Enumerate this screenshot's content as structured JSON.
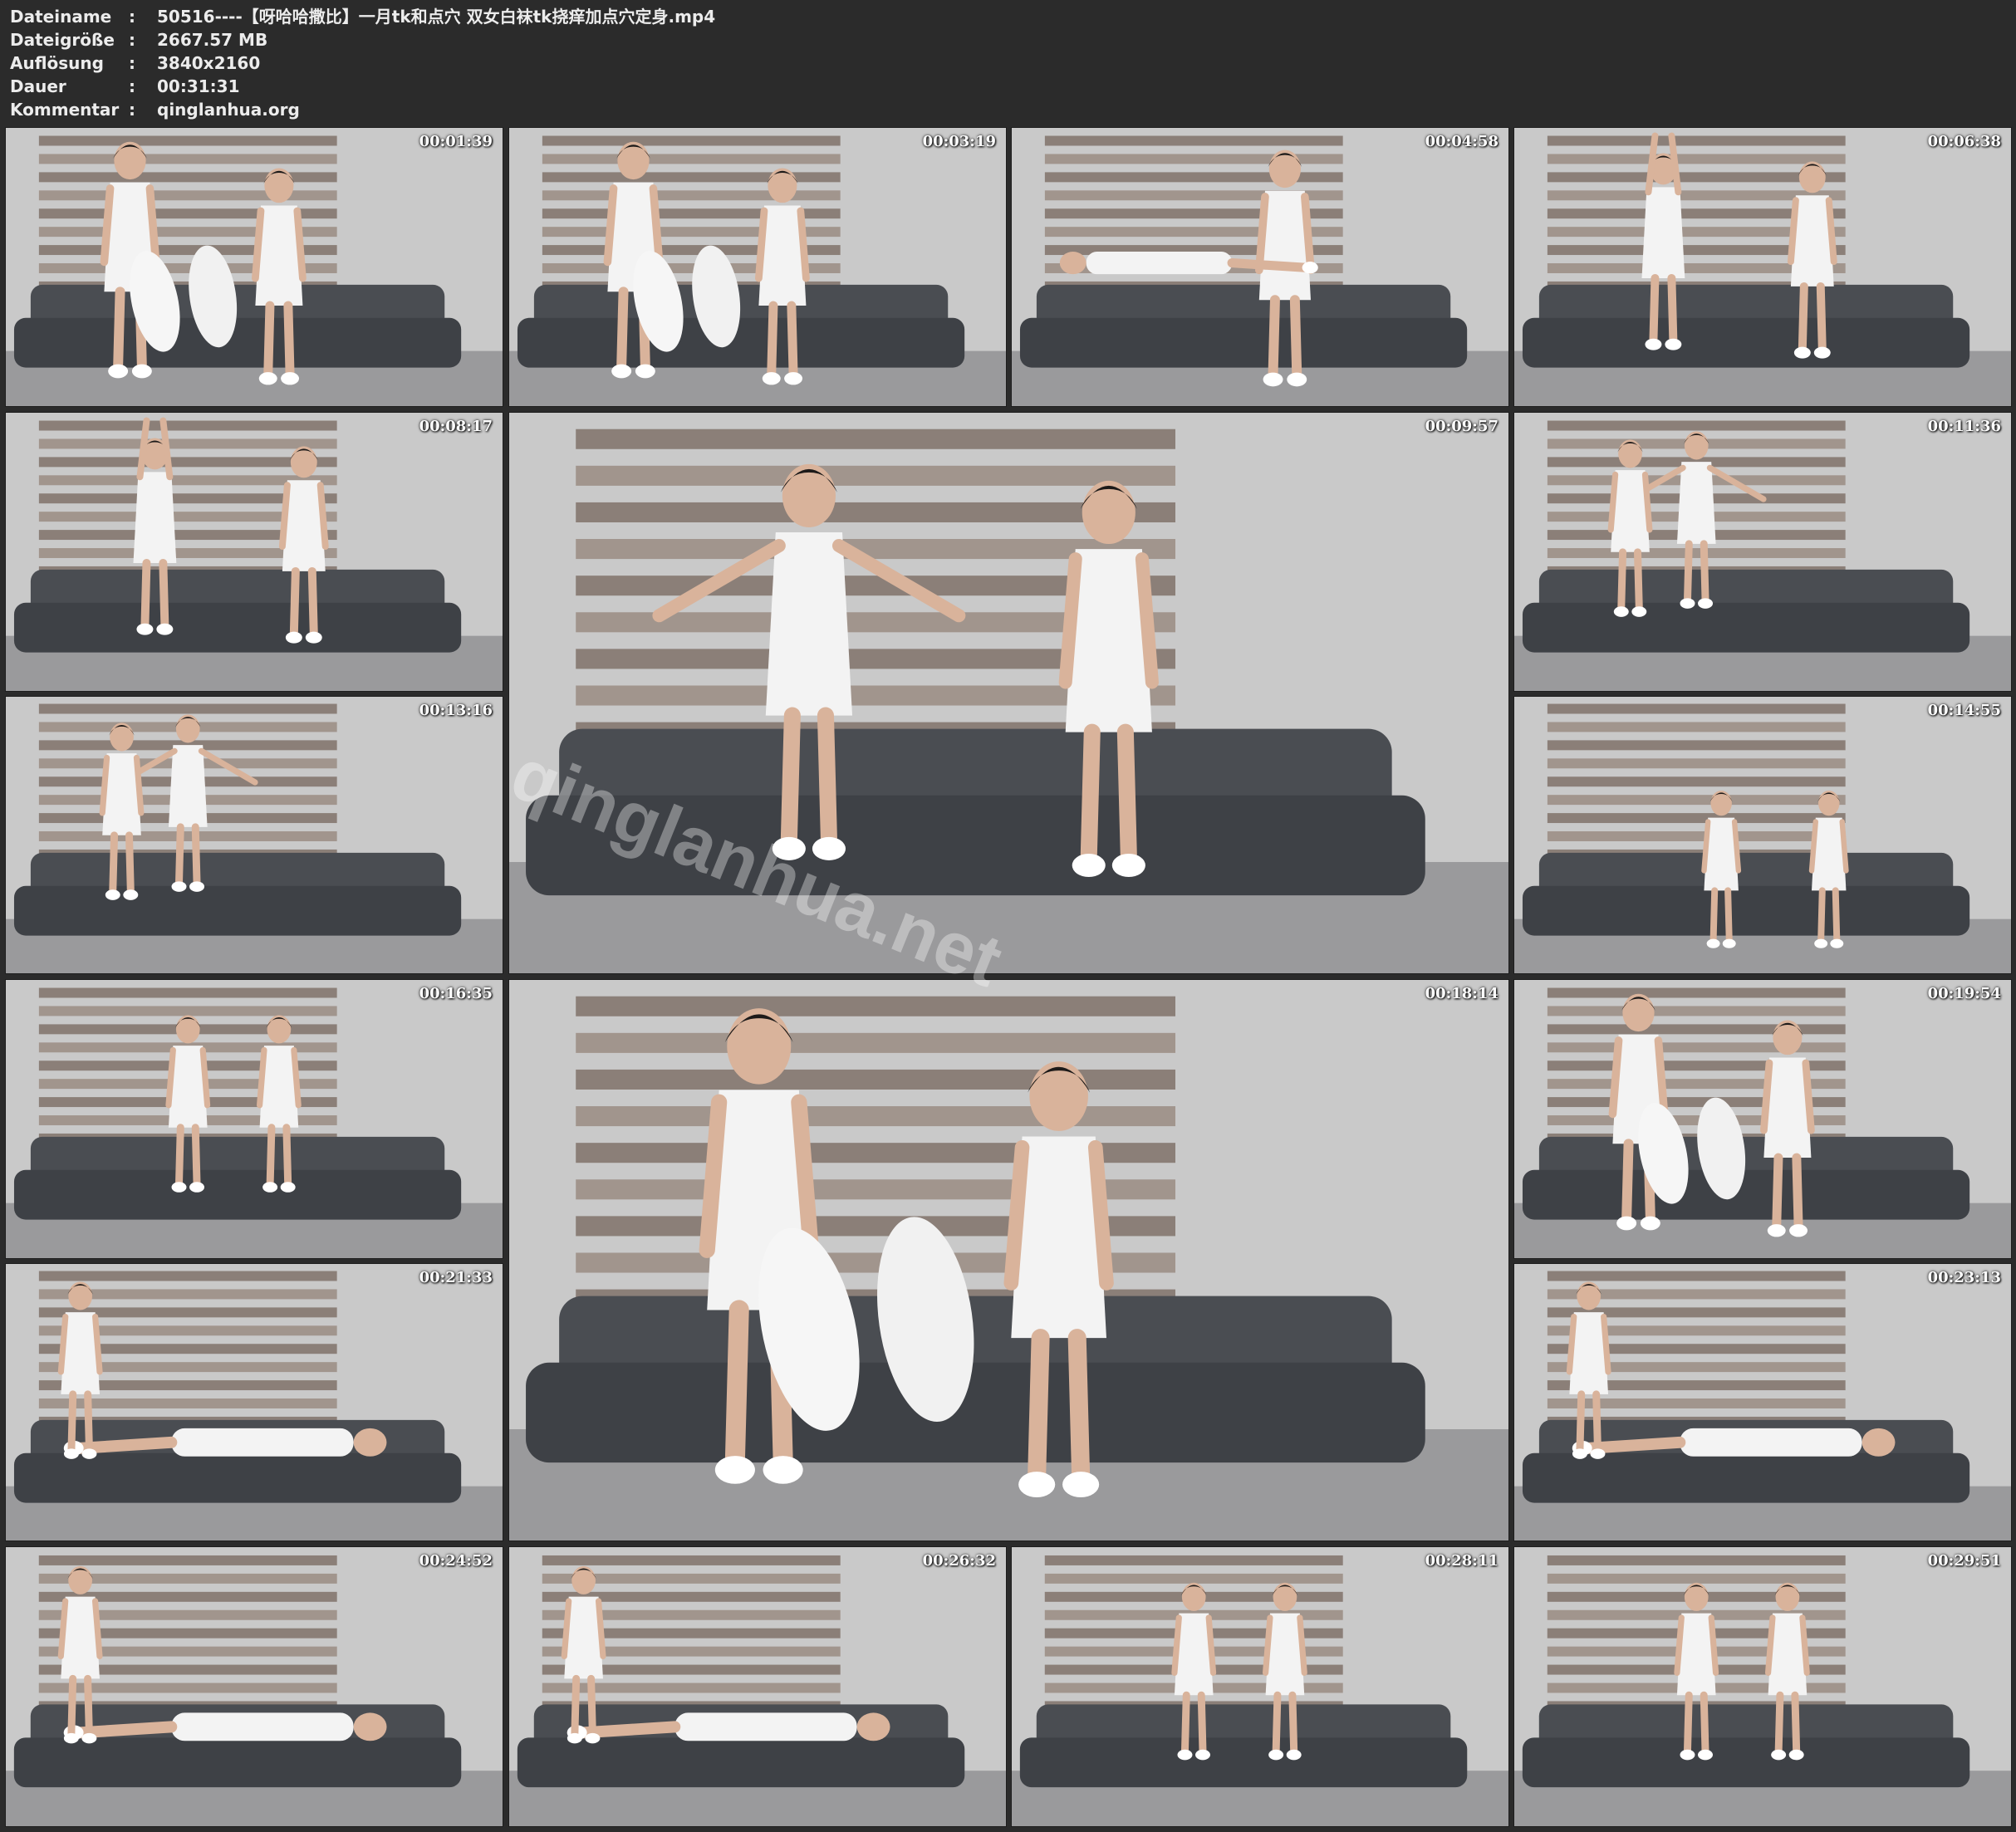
{
  "meta": {
    "filename_label": "Dateiname",
    "filename": "50516----【呀哈哈撒比】一月tk和点穴 双女白袜tk挠痒加点穴定身.mp4",
    "filesize_label": "Dateigröße",
    "filesize": "2667.57 MB",
    "resolution_label": "Auflösung",
    "resolution": "3840x2160",
    "duration_label": "Dauer",
    "duration": "00:31:31",
    "comment_label": "Kommentar",
    "comment": "qinglanhua.org",
    "separator": ":"
  },
  "thumbnails": [
    {
      "time": "00:01:39"
    },
    {
      "time": "00:03:19"
    },
    {
      "time": "00:04:58"
    },
    {
      "time": "00:06:38"
    },
    {
      "time": "00:08:17"
    },
    {
      "time": "00:09:57"
    },
    {
      "time": "00:11:36"
    },
    {
      "time": "00:13:16"
    },
    {
      "time": "00:14:55"
    },
    {
      "time": "00:16:35"
    },
    {
      "time": "00:18:14"
    },
    {
      "time": "00:19:54"
    },
    {
      "time": "00:21:33"
    },
    {
      "time": "00:23:13"
    },
    {
      "time": "00:24:52"
    },
    {
      "time": "00:26:32"
    },
    {
      "time": "00:28:11"
    },
    {
      "time": "00:29:51"
    }
  ],
  "watermark": "qinglanhua.net",
  "colors": {
    "background": "#2b2b2b",
    "text": "#ececec",
    "sofa": "#4a4d52",
    "blinds": "#8b7f78",
    "wall": "#c9c9c9",
    "floor": "#9a9a9c",
    "dress": "#f3f3f3",
    "skin": "#d9b39b"
  }
}
